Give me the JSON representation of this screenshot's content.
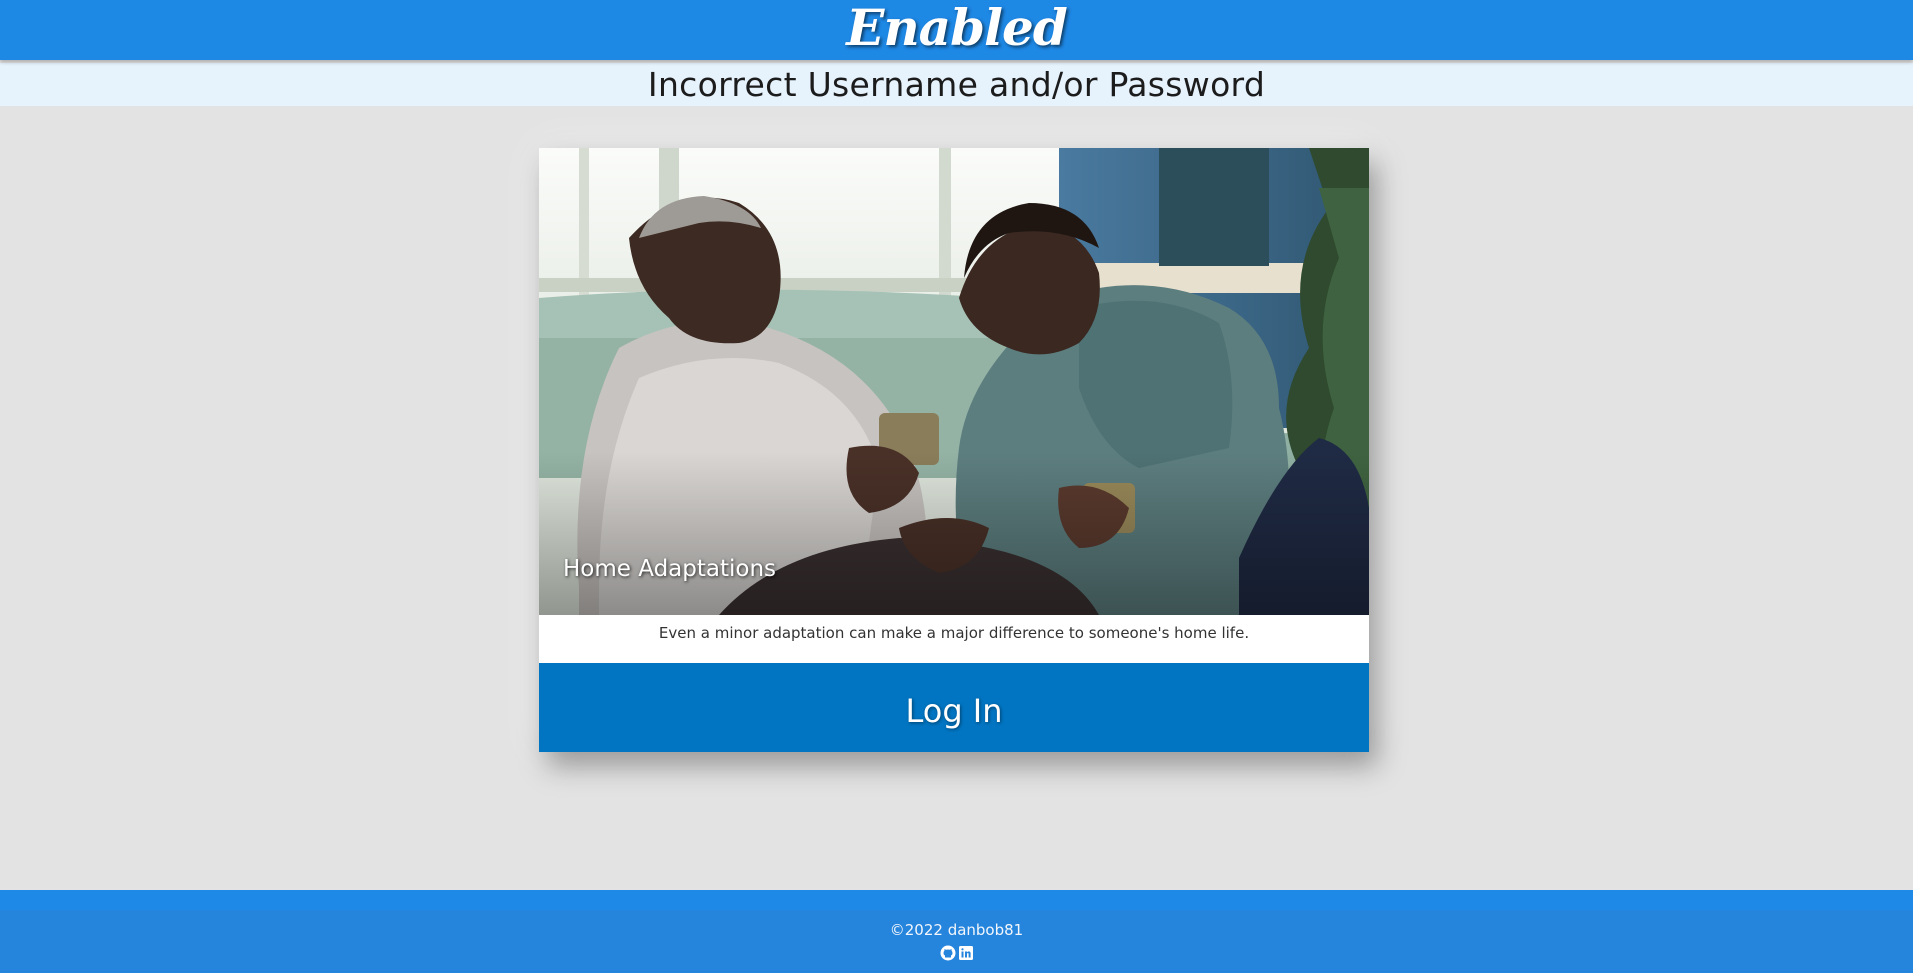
{
  "header": {
    "brand": "Enabled",
    "brand_color": "#1e88e5"
  },
  "alert": {
    "message": "Incorrect Username and/or Password"
  },
  "card": {
    "image_icon": "photo-elderly-couple-icon",
    "caption_title": "Home Adaptations",
    "caption_text": "Even a minor adaptation can make a major difference to someone's home life.",
    "login_label": "Log In",
    "button_color": "#0175c2"
  },
  "footer": {
    "copyright": "©2022 danbob81",
    "links": [
      {
        "icon": "github-icon"
      },
      {
        "icon": "linkedin-icon"
      }
    ]
  }
}
